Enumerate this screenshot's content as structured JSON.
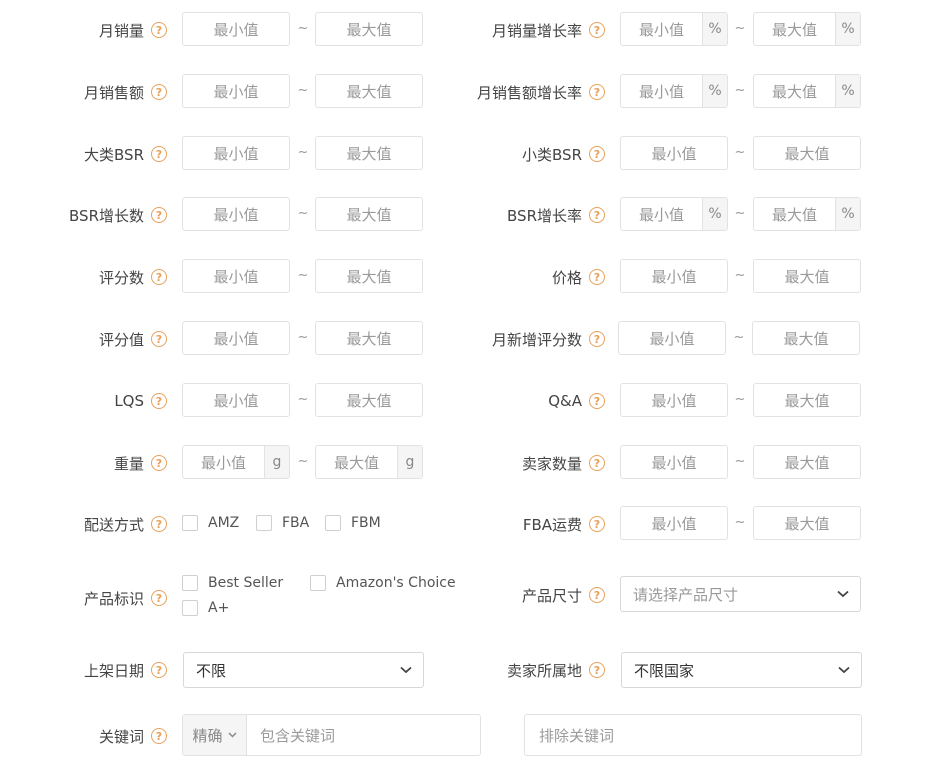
{
  "help_glyph": "?",
  "min_ph": "最小值",
  "max_ph": "最大值",
  "pct": "%",
  "g": "g",
  "sep": "~",
  "rows": {
    "monthly_sales": "月销量",
    "monthly_sales_growth": "月销量增长率",
    "monthly_revenue": "月销售额",
    "monthly_revenue_growth": "月销售额增长率",
    "major_bsr": "大类BSR",
    "minor_bsr": "小类BSR",
    "bsr_growth_count": "BSR增长数",
    "bsr_growth_rate": "BSR增长率",
    "rating_count": "评分数",
    "price": "价格",
    "rating_value": "评分值",
    "monthly_new_ratings": "月新增评分数",
    "lqs": "LQS",
    "qa": "Q&A",
    "weight": "重量",
    "seller_count": "卖家数量",
    "shipping": "配送方式",
    "fba_fee": "FBA运费",
    "product_tag": "产品标识",
    "product_size": "产品尺寸",
    "launch_date": "上架日期",
    "seller_location": "卖家所属地",
    "keyword": "关键词"
  },
  "shipping_options": [
    "AMZ",
    "FBA",
    "FBM"
  ],
  "tag_options": [
    "Best Seller",
    "Amazon's Choice",
    "A+"
  ],
  "selects": {
    "product_size_ph": "请选择产品尺寸",
    "launch_date_value": "不限",
    "seller_location_value": "不限国家",
    "match_mode": "精确"
  },
  "keyword": {
    "include_ph": "包含关键词",
    "exclude_ph": "排除关键词"
  }
}
